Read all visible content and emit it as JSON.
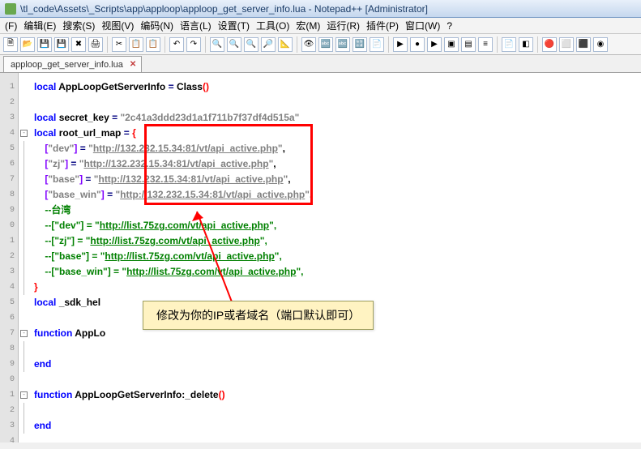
{
  "title": "\\tl_code\\Assets\\_Scripts\\app\\apploop\\apploop_get_server_info.lua - Notepad++ [Administrator]",
  "menus": [
    "(F)",
    "编辑(E)",
    "搜索(S)",
    "视图(V)",
    "编码(N)",
    "语言(L)",
    "设置(T)",
    "工具(O)",
    "宏(M)",
    "运行(R)",
    "插件(P)",
    "窗口(W)",
    "?"
  ],
  "tab": {
    "label": "apploop_get_server_info.lua",
    "close": "✕"
  },
  "lines": [
    "1",
    "2",
    "3",
    "4",
    "5",
    "6",
    "7",
    "8",
    "9",
    "0",
    "1",
    "2",
    "3",
    "4",
    "5",
    "6",
    "7",
    "8",
    "9",
    "0",
    "1",
    "2",
    "3",
    "4"
  ],
  "tool_glyphs": [
    "🗎",
    "📂",
    "💾",
    "💾",
    "✖",
    "🖨",
    "✂",
    "📋",
    "📋",
    "↶",
    "↷",
    "🔍",
    "🔍",
    "🔍",
    "🔎",
    "📐",
    "👁",
    "🔤",
    "🔤",
    "🔡",
    "📄",
    "▶",
    "●",
    "▶",
    "▣",
    "▤",
    "≡",
    "📄",
    "◧",
    "🔴",
    "⬜",
    "⬛",
    "◉"
  ],
  "code": {
    "l1a": "local",
    "l1b": " AppLoopGetServerInfo ",
    "l1c": "=",
    "l1d": " Class",
    "l1e": "()",
    "l3a": "local",
    "l3b": " secret_key ",
    "l3c": "=",
    "l3d": " \"2c41a3ddd23d1a1f711b7f37df4d515a\"",
    "l4a": "local",
    "l4b": " root_url_map ",
    "l4c": "=",
    "l4d": " ",
    "l4e": "{",
    "l5a": "    ",
    "l5b": "[",
    "l5c": "\"dev\"",
    "l5d": "]",
    "l5e": " ",
    "l5f": "=",
    "l5g": " ",
    "l5h": "\"",
    "l5i": "http://132.232.15.34:81/vt/api_active.php",
    "l5j": "\"",
    "l5k": ",",
    "l6a": "    ",
    "l6b": "[",
    "l6c": "\"zj\"",
    "l6d": "]",
    "l6e": " ",
    "l6f": "=",
    "l6g": " ",
    "l6h": "\"",
    "l6i": "http://132.232.15.34:81/vt/api_active.php",
    "l6j": "\"",
    "l6k": ",",
    "l7a": "    ",
    "l7b": "[",
    "l7c": "\"base\"",
    "l7d": "]",
    "l7e": " ",
    "l7f": "=",
    "l7g": " ",
    "l7h": "\"",
    "l7i": "http://132.232.15.34:81/vt/api_active.php",
    "l7j": "\"",
    "l7k": ",",
    "l8a": "    ",
    "l8b": "[",
    "l8c": "\"base_win\"",
    "l8d": "]",
    "l8e": " ",
    "l8f": "=",
    "l8g": " ",
    "l8h": "\"",
    "l8i": "http://132.232.15.34:81/vt/api_active.php",
    "l8j": "\"",
    "l8k": ",",
    "l9": "    --台湾",
    "l10a": "    --[\"dev\"] = \"",
    "l10b": "http://list.75zg.com/vt/api_active.php",
    "l10c": "\",",
    "l11a": "    --[\"zj\"] = \"",
    "l11b": "http://list.75zg.com/vt/api_active.php",
    "l11c": "\",",
    "l12a": "    --[\"base\"] = \"",
    "l12b": "http://list.75zg.com/vt/api_active.php",
    "l12c": "\",",
    "l13a": "    --[\"base_win\"] = \"",
    "l13b": "http://list.75zg.com/vt/api_active.php",
    "l13c": "\",",
    "l14": "}",
    "l15a": "local",
    "l15b": " _sdk_hel",
    "l17a": "function",
    "l17b": " AppLo",
    "l19": "end",
    "l21a": "function",
    "l21b": " AppLoopGetServerInfo:_delete",
    "l21c": "()",
    "l23": "end"
  },
  "callout": "修改为你的IP或者域名（端口默认即可）"
}
